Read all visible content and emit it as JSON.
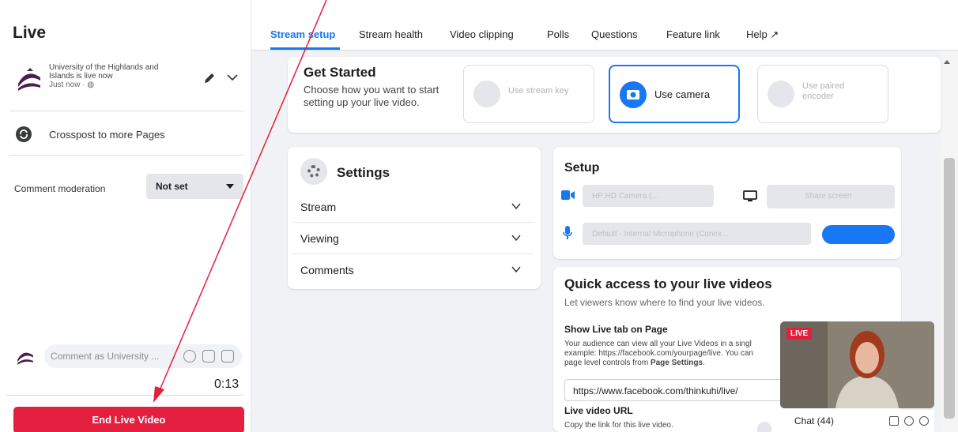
{
  "left": {
    "title": "Live",
    "page_name": "University of the Highlands and Islands is live now",
    "page_status": "Just now · ",
    "crosspost_label": "Crosspost to more Pages",
    "comment_moderation_label": "Comment moderation",
    "comment_moderation_value": "Not set",
    "comment_placeholder": "Comment as University ...",
    "timer": "0:13",
    "end_button": "End Live Video"
  },
  "tabs": [
    {
      "label": "Stream setup"
    },
    {
      "label": "Stream health"
    },
    {
      "label": "Video clipping"
    },
    {
      "label": "Polls"
    },
    {
      "label": "Questions"
    },
    {
      "label": "Feature link"
    },
    {
      "label": "Help ↗"
    }
  ],
  "get_started": {
    "title": "Get Started",
    "description": "Choose how you want to start setting up your live video.",
    "options": [
      {
        "label": "Use stream key"
      },
      {
        "label": "Use camera"
      },
      {
        "label": "Use paired encoder"
      }
    ]
  },
  "settings": {
    "title": "Settings",
    "rows": [
      {
        "label": "Stream"
      },
      {
        "label": "Viewing"
      },
      {
        "label": "Comments"
      }
    ]
  },
  "setup": {
    "title": "Setup",
    "camera_value": "HP HD Camera (...",
    "share_screen": "Share screen",
    "mic_value": "Default - Internal Microphone (Conex..."
  },
  "quick_access": {
    "title": "Quick access to your live videos",
    "subtitle": "Let viewers know where to find your live videos.",
    "live_tab_heading": "Show Live tab on Page",
    "live_tab_body_1": "Your audience can view all your Live Videos in a singl",
    "live_tab_body_2": "example: https://facebook.com/yourpage/live. You can",
    "live_tab_body_3": "page level controls from ",
    "live_tab_body_link": "Page Settings",
    "live_tab_url": "https://www.facebook.com/thinkuhi/live/",
    "video_url_heading": "Live video URL",
    "video_url_body": "Copy the link for this live video."
  },
  "preview": {
    "live_badge": "LIVE",
    "chat_label": "Chat (44)"
  },
  "colors": {
    "accent": "#1877f2",
    "end_button": "#e41e3f",
    "annotation_arrow": "#e41e3f"
  }
}
